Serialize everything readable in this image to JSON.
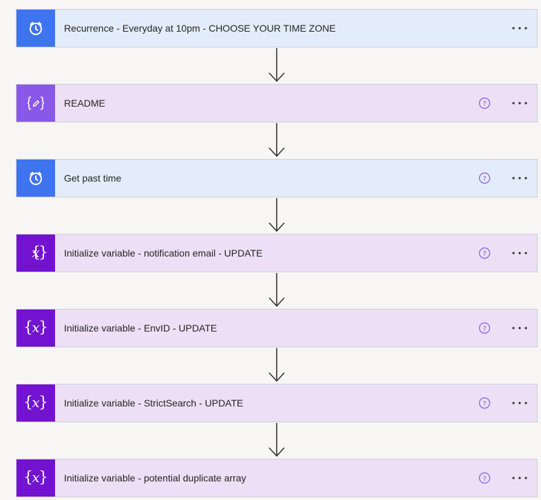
{
  "flow": {
    "steps": [
      {
        "title": "Recurrence - Everyday at 10pm - CHOOSE YOUR TIME ZONE",
        "icon": "alarm-clock-icon",
        "theme": "blue",
        "has_help": false
      },
      {
        "title": "README",
        "icon": "compose-braces-icon",
        "theme": "purple",
        "has_help": true
      },
      {
        "title": "Get past time",
        "icon": "alarm-clock-icon",
        "theme": "blue",
        "has_help": true
      },
      {
        "title": "Initialize variable - notification email - UPDATE",
        "icon": "variable-x-icon",
        "theme": "purple",
        "has_help": true
      },
      {
        "title": "Initialize variable - EnvID - UPDATE",
        "icon": "variable-x-icon",
        "theme": "purple",
        "has_help": true
      },
      {
        "title": "Initialize variable - StrictSearch - UPDATE",
        "icon": "variable-x-icon",
        "theme": "purple",
        "has_help": true
      },
      {
        "title": "Initialize variable - potential duplicate array",
        "icon": "variable-x-icon",
        "theme": "purple",
        "has_help": true
      }
    ],
    "icons": {
      "more_options": "more-options-icon",
      "help": "help-circle-icon",
      "connector": "down-arrow-icon"
    }
  },
  "colors": {
    "clock_tile": "#3f74ef",
    "compose_tile": "#8a58e8",
    "variable_tile": "#7313cf",
    "blue_card": "#e3ecfa",
    "purple_card": "#ecdff6",
    "help_icon": "#8a58e8"
  }
}
